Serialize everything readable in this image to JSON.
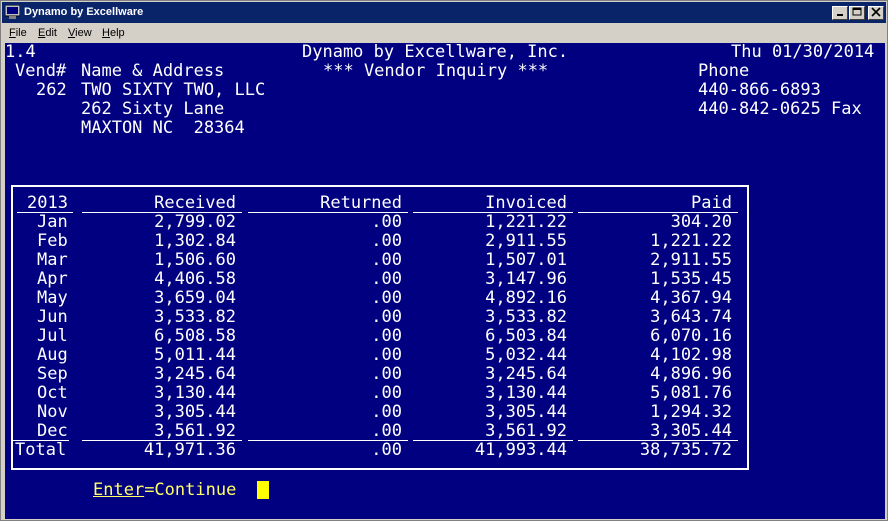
{
  "window": {
    "title": "Dynamo by Excellware"
  },
  "menu": [
    {
      "label": "File",
      "hotkey": "F",
      "rest": "ile"
    },
    {
      "label": "Edit",
      "hotkey": "E",
      "rest": "dit"
    },
    {
      "label": "View",
      "hotkey": "V",
      "rest": "iew"
    },
    {
      "label": "Help",
      "hotkey": "H",
      "rest": "elp"
    }
  ],
  "screen": {
    "version": "1.4",
    "company": "Dynamo by Excellware, Inc.",
    "date": "Thu 01/30/2014",
    "subtitle": "*** Vendor Inquiry ***",
    "vend_label": "Vend#",
    "name_label": "Name & Address",
    "phone_label": "Phone",
    "vendor_number": "262",
    "vendor_name": "TWO SIXTY TWO, LLC",
    "address1": "262 Sixty Lane",
    "address2": "MAXTON NC  28364",
    "phone1": "440-866-6893",
    "phone2": "440-842-0625 Fax"
  },
  "table": {
    "year": "2013",
    "headers": [
      "Received",
      "Returned",
      "Invoiced",
      "Paid"
    ],
    "rows": [
      {
        "month": "Jan",
        "received": "2,799.02",
        "returned": ".00",
        "invoiced": "1,221.22",
        "paid": "304.20"
      },
      {
        "month": "Feb",
        "received": "1,302.84",
        "returned": ".00",
        "invoiced": "2,911.55",
        "paid": "1,221.22"
      },
      {
        "month": "Mar",
        "received": "1,506.60",
        "returned": ".00",
        "invoiced": "1,507.01",
        "paid": "2,911.55"
      },
      {
        "month": "Apr",
        "received": "4,406.58",
        "returned": ".00",
        "invoiced": "3,147.96",
        "paid": "1,535.45"
      },
      {
        "month": "May",
        "received": "3,659.04",
        "returned": ".00",
        "invoiced": "4,892.16",
        "paid": "4,367.94"
      },
      {
        "month": "Jun",
        "received": "3,533.82",
        "returned": ".00",
        "invoiced": "3,533.82",
        "paid": "3,643.74"
      },
      {
        "month": "Jul",
        "received": "6,508.58",
        "returned": ".00",
        "invoiced": "6,503.84",
        "paid": "6,070.16"
      },
      {
        "month": "Aug",
        "received": "5,011.44",
        "returned": ".00",
        "invoiced": "5,032.44",
        "paid": "4,102.98"
      },
      {
        "month": "Sep",
        "received": "3,245.64",
        "returned": ".00",
        "invoiced": "3,245.64",
        "paid": "4,896.96"
      },
      {
        "month": "Oct",
        "received": "3,130.44",
        "returned": ".00",
        "invoiced": "3,130.44",
        "paid": "5,081.76"
      },
      {
        "month": "Nov",
        "received": "3,305.44",
        "returned": ".00",
        "invoiced": "3,305.44",
        "paid": "1,294.32"
      },
      {
        "month": "Dec",
        "received": "3,561.92",
        "returned": ".00",
        "invoiced": "3,561.92",
        "paid": "3,305.44"
      }
    ],
    "total": {
      "label": "Total",
      "received": "41,971.36",
      "returned": ".00",
      "invoiced": "41,993.44",
      "paid": "38,735.72"
    }
  },
  "prompt": {
    "key": "Enter",
    "rest": "=Continue"
  }
}
